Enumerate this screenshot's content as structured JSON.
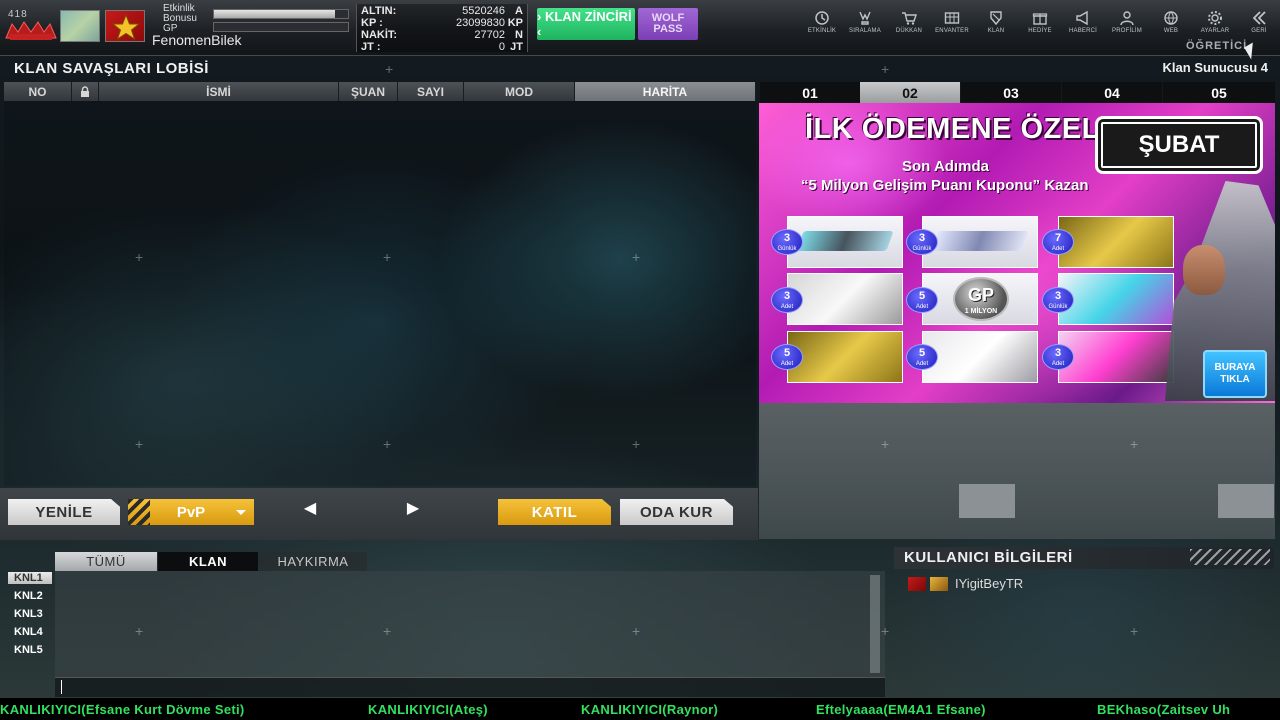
{
  "player": {
    "level": "418",
    "event_bonus_label": "Etkinlik\nBonusu",
    "event_bonus_progress": 0.9,
    "gp_label": "GP",
    "gp_progress": 0.0,
    "username": "FenomenBilek"
  },
  "currencies": [
    {
      "label": "ALTIN:",
      "value": "5520246",
      "unit": "A"
    },
    {
      "label": "KP :",
      "value": "23099830",
      "unit": "KP"
    },
    {
      "label": "NAKİT:",
      "value": "27702",
      "unit": "N"
    },
    {
      "label": "JT  :",
      "value": "0",
      "unit": "JT"
    }
  ],
  "buttons": {
    "clan_chain": "› KLAN ZİNCİRİ ‹",
    "wolf_pass_line1": "WOLF",
    "wolf_pass_line2": "PASS"
  },
  "nav": [
    {
      "label": "ETKİNLİK",
      "icon": "clock-icon"
    },
    {
      "label": "SIRALAMA",
      "icon": "trophy-icon"
    },
    {
      "label": "DÜKKAN",
      "icon": "cart-icon"
    },
    {
      "label": "ENVANTER",
      "icon": "inventory-icon"
    },
    {
      "label": "KLAN",
      "icon": "shield-icon"
    },
    {
      "label": "HEDİYE",
      "icon": "gift-icon"
    },
    {
      "label": "HABERCİ",
      "icon": "megaphone-icon"
    },
    {
      "label": "PROFİLİM",
      "icon": "profile-icon"
    },
    {
      "label": "WEB",
      "icon": "globe-icon"
    },
    {
      "label": "AYARLAR",
      "icon": "gear-icon"
    },
    {
      "label": "GERİ",
      "icon": "back-icon"
    }
  ],
  "tutorial_label": "ÖĞRETİCİ",
  "lobby": {
    "title": "KLAN SAVAŞLARI LOBİSİ",
    "server": "Klan Sunucusu 4",
    "columns": [
      "NO",
      "",
      "İSMİ",
      "ŞUAN",
      "SAYI",
      "MOD",
      "HARİTA"
    ],
    "sorted_column": "HARİTA"
  },
  "banner": {
    "tabs": [
      "01",
      "02",
      "03",
      "04",
      "05"
    ],
    "active_tab": "02",
    "title": "İLK ÖDEMENE ÖZEL",
    "month": "ŞUBAT",
    "sub1": "Son Adımda",
    "sub2": "“5 Milyon Gelişim Puanı Kuponu” Kazan",
    "prizes": [
      {
        "count": "3",
        "unit": "Günlük"
      },
      {
        "count": "3",
        "unit": "Günlük"
      },
      {
        "count": "7",
        "unit": "Adet"
      },
      {
        "count": "3",
        "unit": "Adet"
      },
      {
        "count": "5",
        "unit": "Adet"
      },
      {
        "count": "3",
        "unit": "Günlük"
      },
      {
        "count": "5",
        "unit": "Adet"
      },
      {
        "count": "5",
        "unit": "Adet"
      },
      {
        "count": "3",
        "unit": "Adet"
      }
    ],
    "gp_coin_big": "GP",
    "gp_coin_small": "1 MİLYON",
    "click_line1": "BURAYA",
    "click_line2": "TIKLA"
  },
  "actions": {
    "refresh": "YENİLE",
    "mode": "PvP",
    "join": "KATIL",
    "create_room": "ODA KUR"
  },
  "chat": {
    "tabs": [
      "TÜMÜ",
      "KLAN",
      "HAYKIRMA"
    ],
    "active_tab": "TÜMÜ",
    "channels": [
      "KNL1",
      "KNL2",
      "KNL3",
      "KNL4",
      "KNL5"
    ],
    "active_channel": "KNL1",
    "input_value": ""
  },
  "user_info": {
    "title": "KULLANICI BİLGİLERİ",
    "users": [
      "IYigitBeyTR"
    ]
  },
  "ticker": [
    "KANLIKIYICI(Efsane Kurt Dövme Seti)",
    "KANLIKIYICI(Ateş)",
    "KANLIKIYICI(Raynor)",
    "Eftelyaaaa(EM4A1 Efsane)",
    "BEKhaso(Zaitsev Uh"
  ],
  "colors": {
    "accent_gold": "#d89a10",
    "accent_green": "#1eb35f",
    "accent_purple": "#7b3fb4",
    "ticker_green": "#33e05e"
  }
}
